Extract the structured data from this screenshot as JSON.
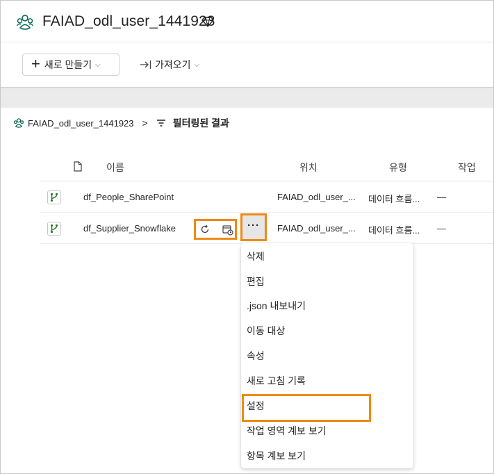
{
  "header": {
    "workspace_title": "FAIAD_odl_user_1441923",
    "workspace_icon": "workspace-people-icon",
    "premium_icon": "diamond-icon"
  },
  "toolbar": {
    "new_label": "새로 만들기",
    "import_label": "가져오기"
  },
  "breadcrumb": {
    "workspace": "FAIAD_odl_user_1441923",
    "separator": ">",
    "filter_label": "필터링된 결과"
  },
  "table": {
    "columns": {
      "name": "이름",
      "location": "위치",
      "type": "유형",
      "action": "작업"
    },
    "rows": [
      {
        "name": "df_People_SharePoint",
        "location": "FAIAD_odl_user_...",
        "type": "데이터 흐름...",
        "action": "—"
      },
      {
        "name": "df_Supplier_Snowflake",
        "location": "FAIAD_odl_user_...",
        "type": "데이터 흐름...",
        "action": "—"
      }
    ],
    "more_label": "···"
  },
  "context_menu": {
    "items": [
      "삭제",
      "편집",
      ".json 내보내기",
      "이동 대상",
      "속성",
      "새로 고침 기록",
      "설정",
      "작업 영역 계보 보기",
      "항목 계보 보기"
    ],
    "highlighted_item": "설정"
  },
  "colors": {
    "highlight": "#ee8a14",
    "dataflow_icon": "#2e7d32"
  }
}
